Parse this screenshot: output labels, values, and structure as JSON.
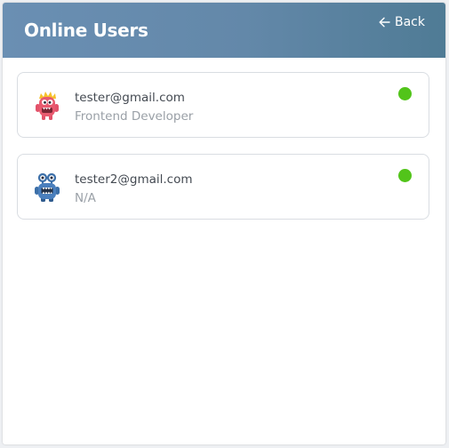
{
  "header": {
    "title": "Online Users",
    "back_label": "Back"
  },
  "users": [
    {
      "email": "tester@gmail.com",
      "role": "Frontend Developer",
      "avatar_icon": "red-monster-icon",
      "status": "online",
      "status_color": "#52c41a"
    },
    {
      "email": "tester2@gmail.com",
      "role": "N/A",
      "avatar_icon": "blue-robot-icon",
      "status": "online",
      "status_color": "#52c41a"
    }
  ],
  "colors": {
    "header_gradient_start": "#6a8fb3",
    "header_gradient_end": "#4f7b95",
    "online": "#52c41a",
    "card_border": "#d9dde2"
  }
}
